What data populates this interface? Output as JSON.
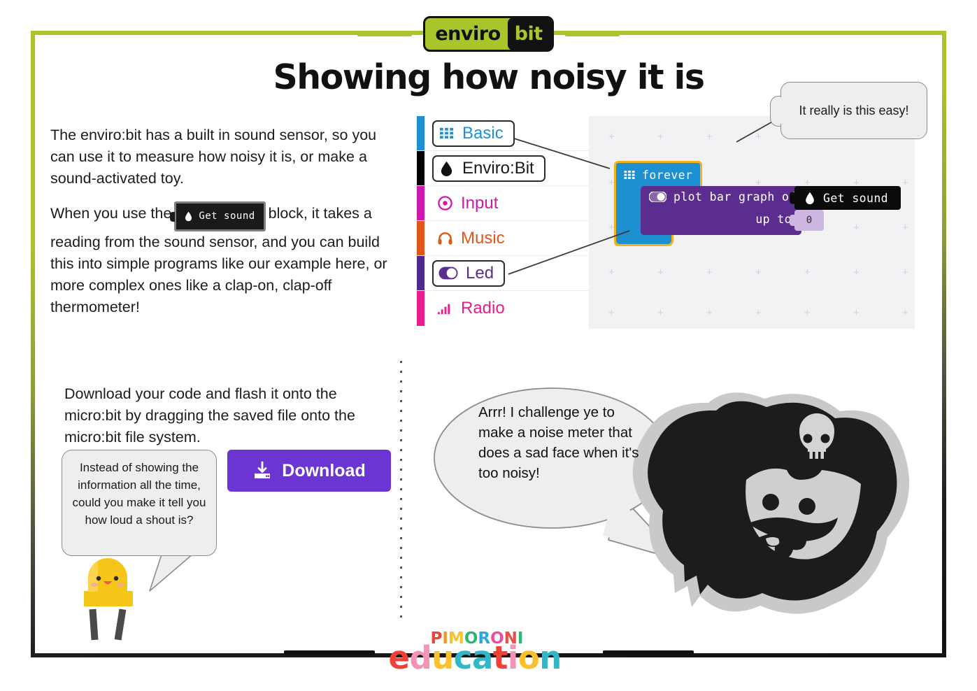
{
  "logo": {
    "enviro": "enviro",
    "bit": "bit",
    "accent_color": "#a8c62c"
  },
  "title": "Showing how noisy it is",
  "paragraphs": {
    "p1": "The enviro:bit has a built in sound sensor, so you can use it to measure how noisy it is, or make a sound-activated toy.",
    "p2_before": "When you use the",
    "p2_chip": "Get sound",
    "p2_after": "block, it takes a reading from the sound sensor, and you can build this into simple programs like our example here, or more complex ones like a clap-on, clap-off thermometer!",
    "download_text": "Download your code and flash it onto the micro:bit by dragging the saved file onto the micro:bit file system."
  },
  "editor": {
    "categories": [
      {
        "label": "Basic",
        "color": "#1e90d2",
        "text_color": "#1e90d2",
        "icon": "grid-icon",
        "outlined": true
      },
      {
        "label": "Enviro:Bit",
        "color": "#000000",
        "text_color": "#1a1a1a",
        "icon": "drop-icon",
        "outlined": true
      },
      {
        "label": "Input",
        "color": "#cf18ad",
        "text_color": "#cf18ad",
        "icon": "target-icon",
        "outlined": false
      },
      {
        "label": "Music",
        "color": "#e0561b",
        "text_color": "#e0561b",
        "icon": "headphones-icon",
        "outlined": false
      },
      {
        "label": "Led",
        "color": "#4a2a8e",
        "text_color": "#5b2d8e",
        "icon": "toggle-icon",
        "outlined": true
      },
      {
        "label": "Radio",
        "color": "#e81c8a",
        "text_color": "#e81c8a",
        "icon": "signal-bars-icon",
        "outlined": false
      }
    ],
    "blocks": {
      "forever": "forever",
      "plot_line1": "plot bar graph of",
      "plot_line2": "up to",
      "get_sound": "Get sound",
      "up_to_value": "0"
    },
    "colors": {
      "forever_block": "#1e90d2",
      "plot_block": "#5b2d8e",
      "get_sound_block": "#0b0b0b",
      "value_field": "#cdb6e0",
      "selection_outline": "#f2b21a",
      "workspace_bg": "#f2f2f4"
    }
  },
  "bubbles": {
    "easy": "It really is this easy!",
    "led": "Instead of showing the information all the time, could you make it tell you how loud a shout is?",
    "pirate": "Arrr! I challenge ye to make a noise meter that does a sad face when it's too noisy!"
  },
  "download_button": {
    "label": "Download",
    "color": "#6b35d4",
    "icon": "download-icon"
  },
  "footer": {
    "pimoroni": "PIMORONI",
    "education": "education",
    "pimoroni_letters": [
      {
        "ch": "P",
        "color": "#ef4136"
      },
      {
        "ch": "I",
        "color": "#f7941e"
      },
      {
        "ch": "M",
        "color": "#f9c22b"
      },
      {
        "ch": "O",
        "color": "#2bb673"
      },
      {
        "ch": "R",
        "color": "#27aae1"
      },
      {
        "ch": "O",
        "color": "#ee4d9b"
      },
      {
        "ch": "N",
        "color": "#f04e3e"
      },
      {
        "ch": "I",
        "color": "#2bb673"
      }
    ],
    "education_letters": [
      {
        "ch": "e",
        "color": "#ef4136"
      },
      {
        "ch": "d",
        "color": "#f493b8"
      },
      {
        "ch": "u",
        "color": "#fbc02d"
      },
      {
        "ch": "c",
        "color": "#31b7c8"
      },
      {
        "ch": "a",
        "color": "#31b7c8"
      },
      {
        "ch": "t",
        "color": "#ef4136"
      },
      {
        "ch": "i",
        "color": "#f493b8"
      },
      {
        "ch": "o",
        "color": "#fbc02d"
      },
      {
        "ch": "n",
        "color": "#31b7c8"
      }
    ]
  }
}
